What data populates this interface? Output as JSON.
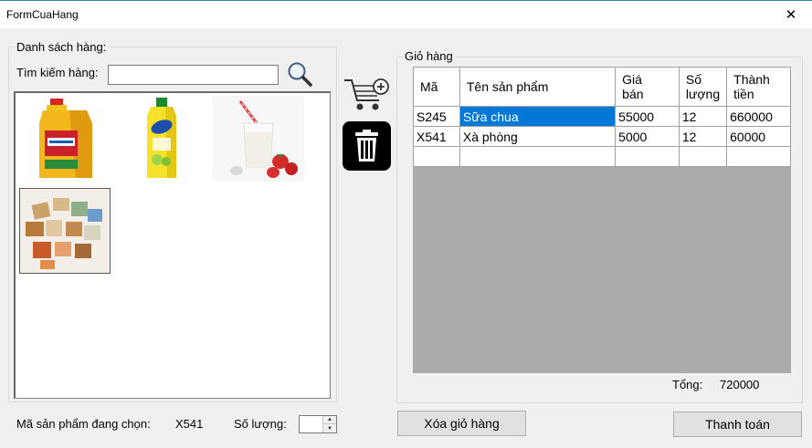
{
  "window": {
    "title": "FormCuaHang",
    "close_glyph": "✕"
  },
  "product_panel": {
    "label": "Danh sách hàng:",
    "search_label": "Tìm kiếm hàng:",
    "search_value": "",
    "products": [
      {
        "name": "cooking-oil-bottle"
      },
      {
        "name": "dish-soap-bottle"
      },
      {
        "name": "yogurt-glass-with-strawberries"
      },
      {
        "name": "soap-bars"
      }
    ],
    "selected_index": 3
  },
  "cart": {
    "label": "Giỏ hàng",
    "columns": [
      "Mã",
      "Tên sản phẩm",
      "Giá\nbán",
      "Số\nlượng",
      "Thành\ntiền"
    ],
    "rows": [
      [
        "S245",
        "Sữa chua",
        "55000",
        "12",
        "660000"
      ],
      [
        "X541",
        "Xà phòng",
        "5000",
        "12",
        "60000"
      ],
      [
        "",
        "",
        "",
        "",
        ""
      ]
    ],
    "selected_cell": {
      "row": 0,
      "col": 1
    },
    "total_label": "Tổng:",
    "total_value": "720000"
  },
  "footer": {
    "selected_code_label": "Mã sản phẩm đang chọn:",
    "selected_code_value": "X541",
    "quantity_label": "Số lượng:",
    "quantity_value": "",
    "clear_cart_label": "Xóa giỏ hàng",
    "checkout_label": "Thanh toán"
  },
  "colors": {
    "selection": "#0078d7",
    "grid_empty": "#ababab",
    "window_bg": "#f0f0f0"
  }
}
